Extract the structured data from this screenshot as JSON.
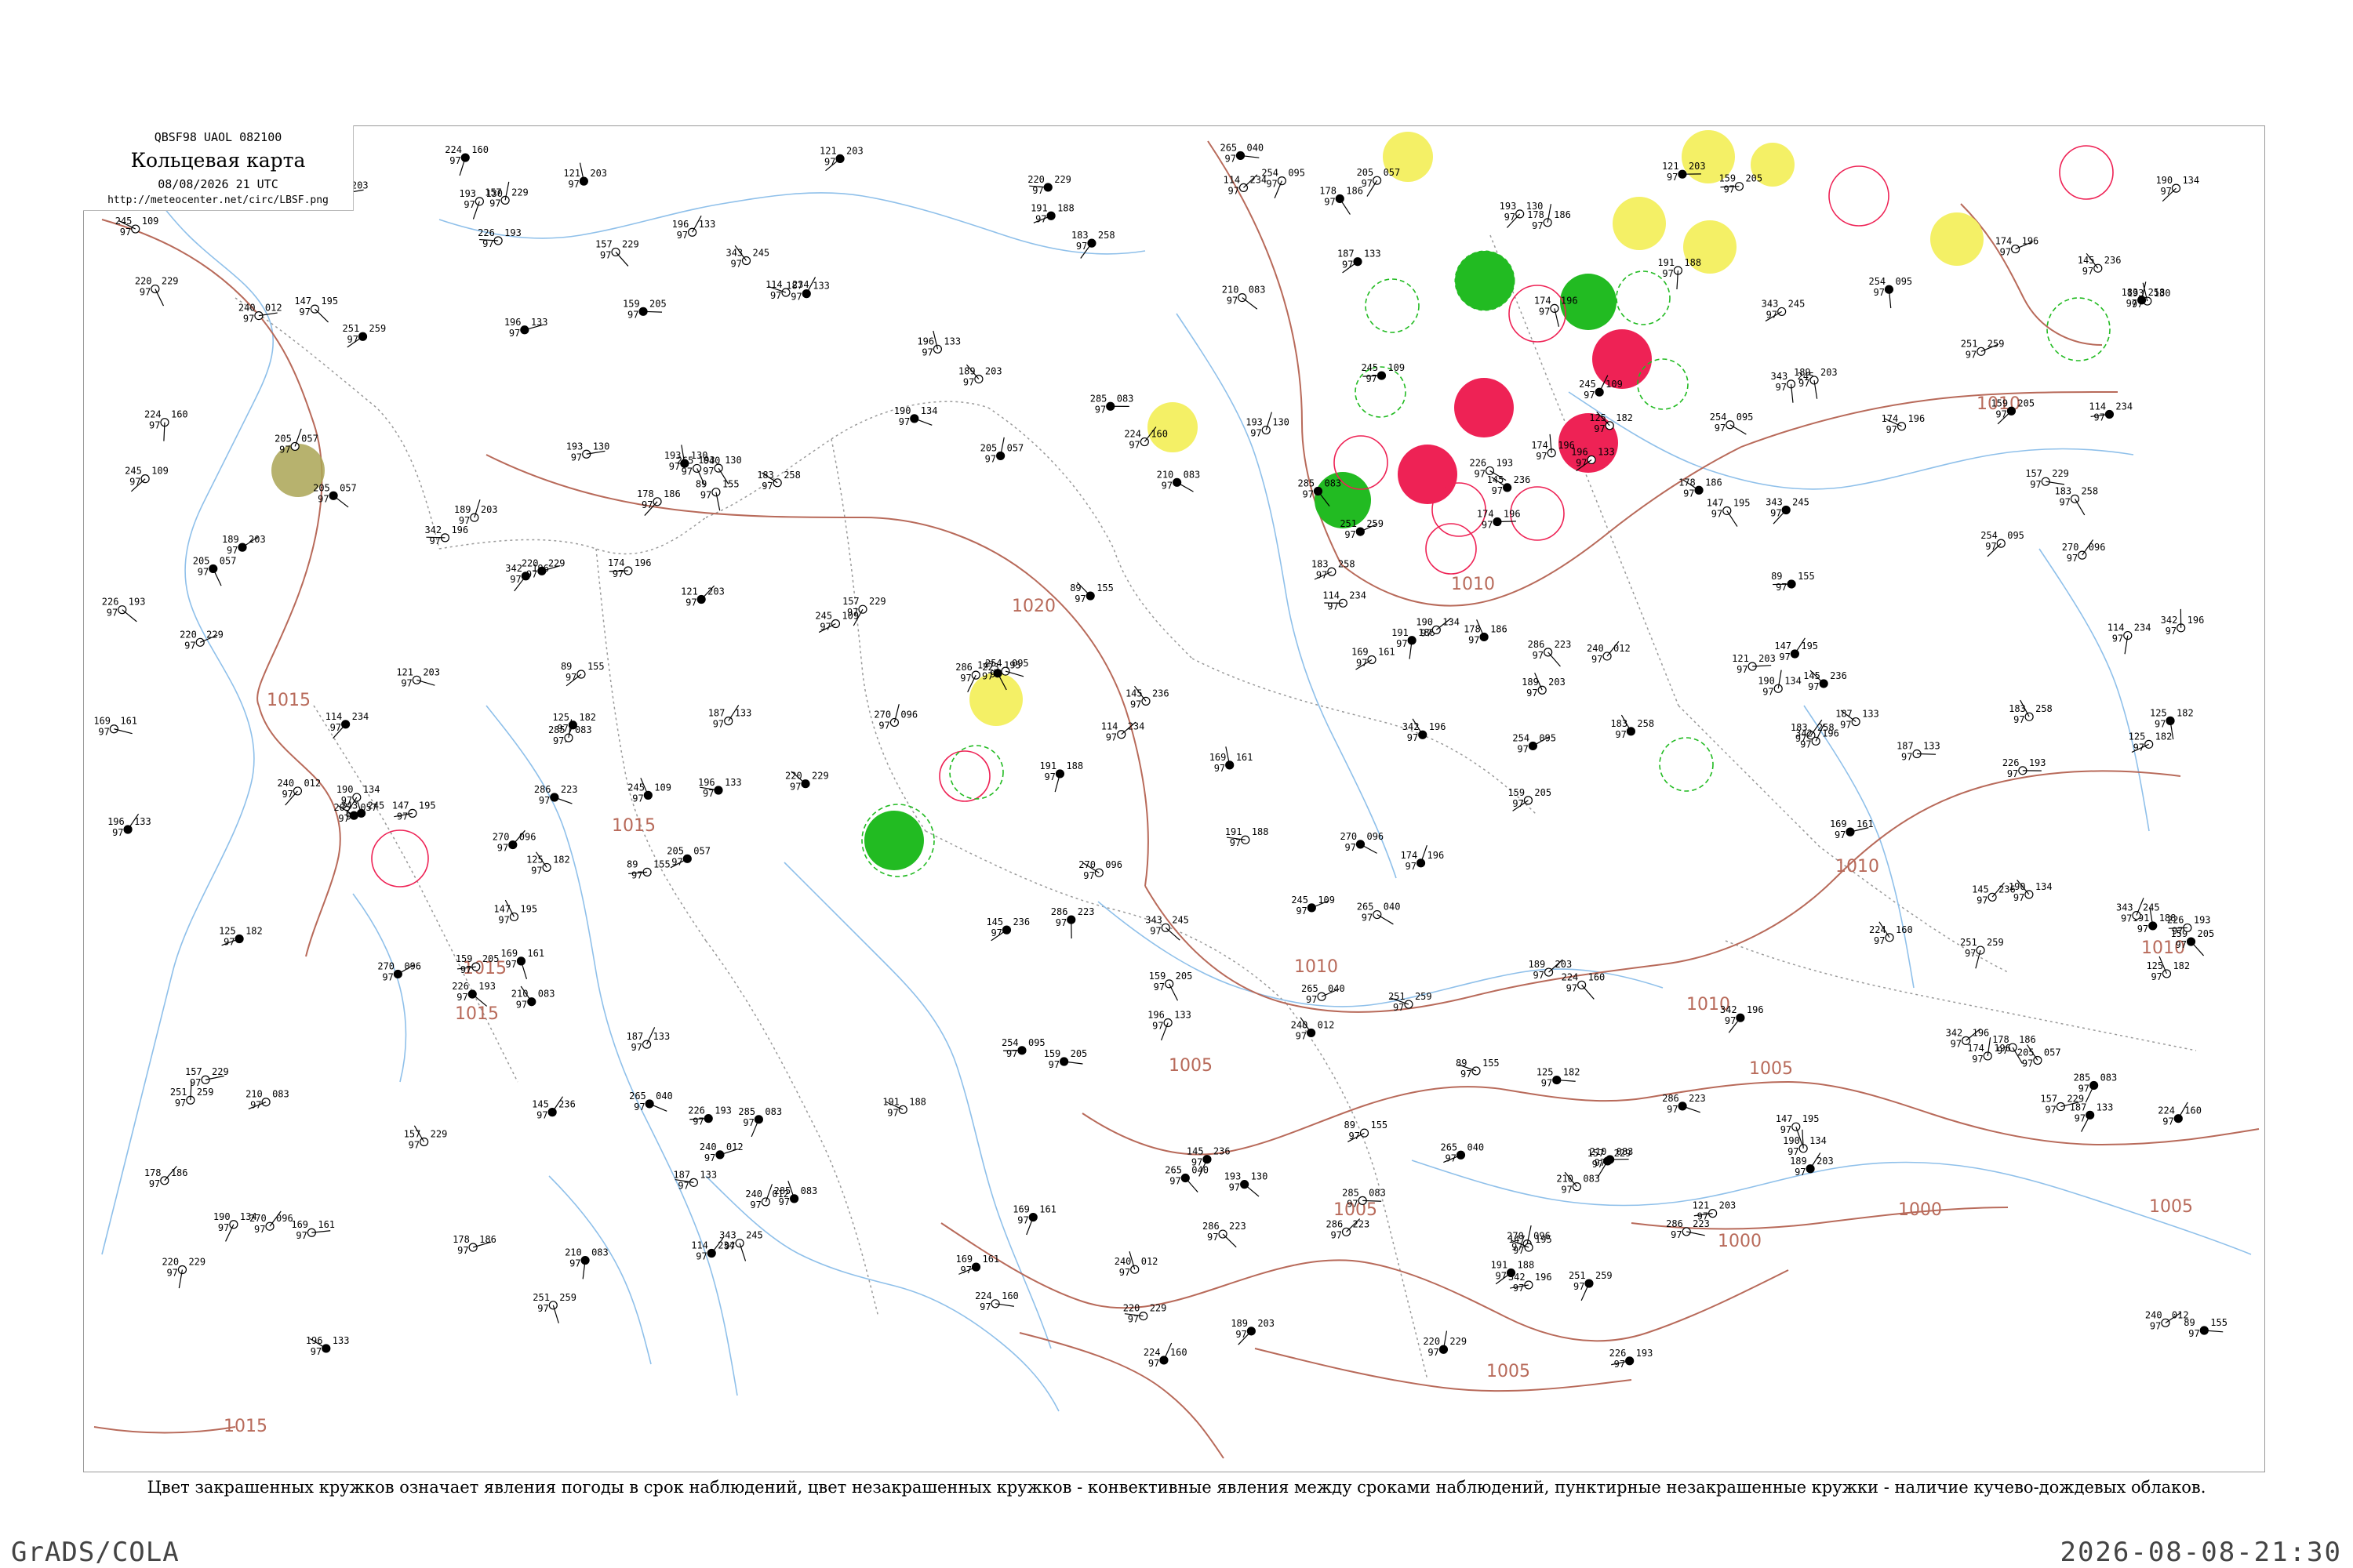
{
  "header": {
    "code_line": "QBSF98  UAOL  082100",
    "title": "Кольцевая карта",
    "datetime": "08/08/2026 21 UTC",
    "url": "http://meteocenter.net/circ/LBSF.png"
  },
  "legend_note": "Цвет закрашенных кружков означает явления погоды в срок наблюдений, цвет незакрашенных кружков - конвективные явления между сроками наблюдений, пунктирные незакрашенные кружки - наличие кучево-дождевых облаков.",
  "footer": {
    "left": "GrADS/COLA",
    "right": "2026-08-08-21:30"
  },
  "colors": {
    "isobar": "#b86a5a",
    "water": "#8fc0ea",
    "border": "#888888",
    "green": "#22bb22",
    "red": "#ee2255",
    "yellow": "#f4f066",
    "olive": "#aaa455"
  },
  "isobar_labels": [
    "1015",
    "1015",
    "1015",
    "1015",
    "1020",
    "1010",
    "1010",
    "1010",
    "1010",
    "1010",
    "1010",
    "1005",
    "1005",
    "1005",
    "1005",
    "1000",
    "1000",
    "1005",
    "1015"
  ],
  "stations": [
    {
      "t": "174",
      "p": "196",
      "c": "k"
    },
    {
      "t": "189",
      "p": "203",
      "c": "k"
    },
    {
      "t": "157",
      "p": "229",
      "c": "k"
    },
    {
      "t": "343",
      "p": "245",
      "c": "k"
    },
    {
      "t": "145",
      "p": "236",
      "c": "k"
    },
    {
      "t": "114",
      "p": "234",
      "c": "k"
    },
    {
      "t": "121",
      "p": "203",
      "c": "k"
    },
    {
      "t": "147",
      "p": "195",
      "c": "k"
    },
    {
      "t": "342",
      "p": "196",
      "c": "k"
    },
    {
      "t": "125",
      "p": "182",
      "c": "y"
    },
    {
      "t": "169",
      "p": "161",
      "c": "k"
    },
    {
      "t": "193",
      "p": "130",
      "c": "y"
    },
    {
      "t": "187",
      "p": "133",
      "c": "r"
    },
    {
      "t": "196",
      "p": "133",
      "c": "k"
    },
    {
      "t": "224",
      "p": "160",
      "c": "o"
    },
    {
      "t": "159",
      "p": "205",
      "c": "y"
    },
    {
      "t": "89",
      "p": "155",
      "c": "y"
    },
    {
      "t": "183",
      "p": "258",
      "c": "g"
    },
    {
      "t": "251",
      "p": "259",
      "c": "g"
    },
    {
      "t": "191",
      "p": "188",
      "c": "k"
    },
    {
      "t": "220",
      "p": "229",
      "c": "k"
    },
    {
      "t": "190",
      "p": "134",
      "c": "y"
    },
    {
      "t": "178",
      "p": "186",
      "c": "k"
    },
    {
      "t": "226",
      "p": "193",
      "c": "k"
    },
    {
      "t": "270",
      "p": "096",
      "c": "k"
    },
    {
      "t": "265",
      "p": "040",
      "c": "k"
    },
    {
      "t": "205",
      "p": "057",
      "c": "k"
    },
    {
      "t": "240",
      "p": "012",
      "c": "k"
    },
    {
      "t": "286",
      "p": "223",
      "c": "k"
    },
    {
      "t": "210",
      "p": "083",
      "c": "k"
    },
    {
      "t": "285",
      "p": "083",
      "c": "k"
    },
    {
      "t": "245",
      "p": "109",
      "c": "k"
    },
    {
      "t": "254",
      "p": "095",
      "c": "k"
    }
  ]
}
